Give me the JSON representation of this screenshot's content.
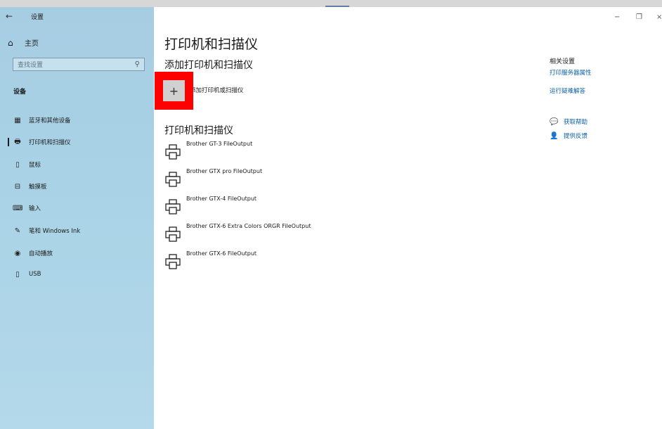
{
  "window": {
    "title": "设置",
    "back_icon": "←",
    "controls": {
      "minimize": "−",
      "restore": "❐",
      "close": "×"
    }
  },
  "sidebar": {
    "home_label": "主页",
    "search_placeholder": "查找设置",
    "section_label": "设备",
    "items": [
      {
        "label": "蓝牙和其他设备",
        "icon": "bluetooth-devices-icon",
        "glyph": "▦"
      },
      {
        "label": "打印机和扫描仪",
        "icon": "printer-icon",
        "glyph": "🖶"
      },
      {
        "label": "鼠标",
        "icon": "mouse-icon",
        "glyph": "▯"
      },
      {
        "label": "触摸板",
        "icon": "touchpad-icon",
        "glyph": "⊟"
      },
      {
        "label": "输入",
        "icon": "keyboard-icon",
        "glyph": "⌨"
      },
      {
        "label": "笔和 Windows Ink",
        "icon": "pen-icon",
        "glyph": "✎"
      },
      {
        "label": "自动播放",
        "icon": "autoplay-icon",
        "glyph": "◉"
      },
      {
        "label": "USB",
        "icon": "usb-icon",
        "glyph": "▯"
      }
    ]
  },
  "main": {
    "title": "打印机和扫描仪",
    "add_section_title": "添加打印机和扫描仪",
    "add_button_glyph": "+",
    "add_button_label": "添加打印机或扫描仪",
    "printers_title": "打印机和扫描仪",
    "printers": [
      "Brother GT-3 FileOutput",
      "Brother GTX pro FileOutput",
      "Brother GTX-4 FileOutput",
      "Brother GTX-6 Extra Colors ORGR FileOutput",
      "Brother GTX-6 FileOutput"
    ]
  },
  "related": {
    "heading": "相关设置",
    "links": [
      "打印服务器属性",
      "运行疑难解答"
    ],
    "help": [
      {
        "label": "获取帮助",
        "icon": "help-icon",
        "glyph": "💬"
      },
      {
        "label": "提供反馈",
        "icon": "feedback-icon",
        "glyph": "👤"
      }
    ]
  },
  "colors": {
    "accent_link": "#0a5fa8",
    "highlight": "#ff0000"
  }
}
